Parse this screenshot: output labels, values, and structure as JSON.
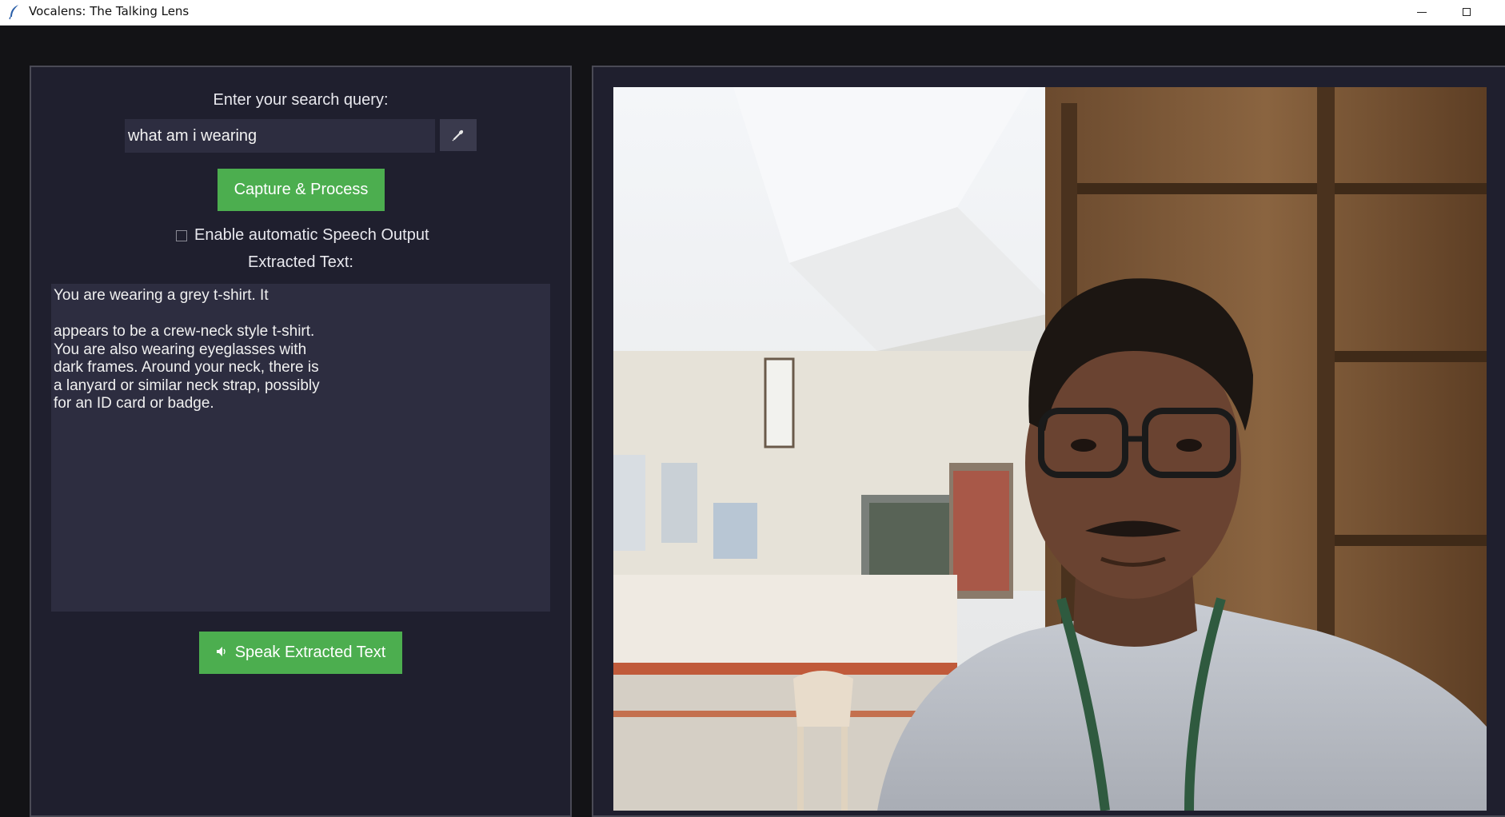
{
  "window": {
    "title": "Vocalens: The Talking Lens",
    "icon": "feather-icon",
    "controls": [
      "minimize",
      "maximize"
    ]
  },
  "left_panel": {
    "query_label": "Enter your search query:",
    "query_value": "what am i wearing",
    "mic_icon": "microphone-icon",
    "capture_button": "Capture & Process",
    "auto_speech_checkbox": {
      "label": "Enable automatic Speech Output",
      "checked": false
    },
    "extracted_label": "Extracted Text:",
    "extracted_text": "You are wearing a grey t-shirt. It\n\nappears to be a crew-neck style t-shirt.\nYou are also wearing eyeglasses with\ndark frames. Around your neck, there is\na lanyard or similar neck strap, possibly\nfor an ID card or badge.",
    "speak_button": "Speak Extracted Text",
    "speak_icon": "speaker-icon"
  },
  "right_panel": {
    "content": "webcam-feed"
  },
  "colors": {
    "background": "#131316",
    "panel": "#1f1f2e",
    "input": "#2d2d40",
    "accent_green": "#4cae4f",
    "text": "#e8e8ee"
  }
}
